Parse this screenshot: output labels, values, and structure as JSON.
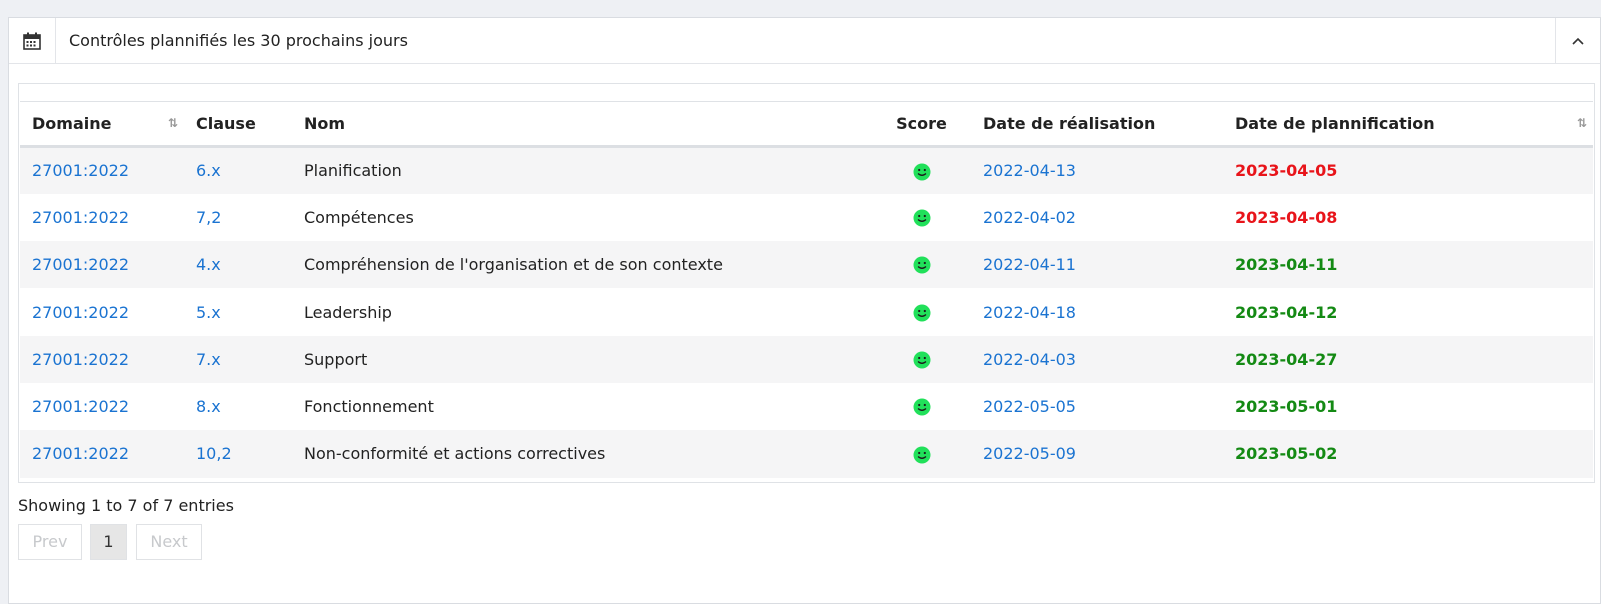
{
  "header": {
    "title": "Contrôles plannifiés les 30 prochains jours",
    "icon": "calendar-icon",
    "toggle_icon": "chevron-up-icon"
  },
  "table": {
    "columns": [
      "Domaine",
      "Clause",
      "Nom",
      "Score",
      "Date de réalisation",
      "Date de plannification"
    ],
    "rows": [
      {
        "domaine": "27001:2022",
        "clause": "6.x",
        "nom": "Planification",
        "score": "smiley-icon",
        "realisation": "2022-04-13",
        "plannification": "2023-04-05",
        "status": "late"
      },
      {
        "domaine": "27001:2022",
        "clause": "7,2",
        "nom": "Compétences",
        "score": "smiley-icon",
        "realisation": "2022-04-02",
        "plannification": "2023-04-08",
        "status": "late"
      },
      {
        "domaine": "27001:2022",
        "clause": "4.x",
        "nom": "Compréhension de l'organisation et de son contexte",
        "score": "smiley-icon",
        "realisation": "2022-04-11",
        "plannification": "2023-04-11",
        "status": "ok"
      },
      {
        "domaine": "27001:2022",
        "clause": "5.x",
        "nom": "Leadership",
        "score": "smiley-icon",
        "realisation": "2022-04-18",
        "plannification": "2023-04-12",
        "status": "ok"
      },
      {
        "domaine": "27001:2022",
        "clause": "7.x",
        "nom": "Support",
        "score": "smiley-icon",
        "realisation": "2022-04-03",
        "plannification": "2023-04-27",
        "status": "ok"
      },
      {
        "domaine": "27001:2022",
        "clause": "8.x",
        "nom": "Fonctionnement",
        "score": "smiley-icon",
        "realisation": "2022-05-05",
        "plannification": "2023-05-01",
        "status": "ok"
      },
      {
        "domaine": "27001:2022",
        "clause": "10,2",
        "nom": "Non-conformité et actions correctives",
        "score": "smiley-icon",
        "realisation": "2022-05-09",
        "plannification": "2023-05-02",
        "status": "ok"
      }
    ]
  },
  "footer": {
    "info": "Showing 1 to 7 of 7 entries",
    "prev": "Prev",
    "page": "1",
    "next": "Next"
  },
  "colors": {
    "link": "#1a73d1",
    "late": "#e8141a",
    "ok": "#148a14",
    "score_good": "#21e05a"
  }
}
